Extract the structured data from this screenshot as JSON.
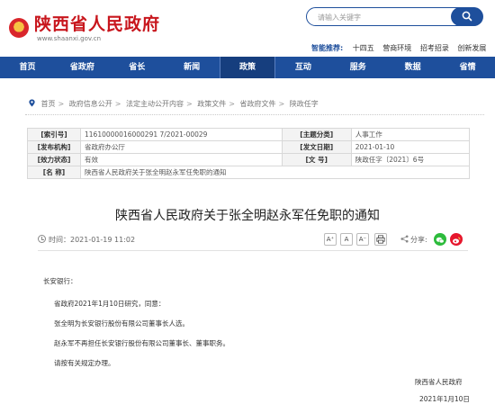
{
  "header": {
    "site_title": "陕西省人民政府",
    "site_url": "www.shaanxi.gov.cn",
    "search_placeholder": "请输入关键字",
    "hot_label": "智能推荐:",
    "hot_items": [
      "十四五",
      "营商环境",
      "招考招录",
      "创新发展"
    ]
  },
  "nav": {
    "tabs": [
      "首页",
      "省政府",
      "省长",
      "新闻",
      "政策",
      "互动",
      "服务",
      "数据",
      "省情"
    ],
    "active_index": 4
  },
  "breadcrumb": [
    "首页",
    "政府信息公开",
    "法定主动公开内容",
    "政策文件",
    "省政府文件",
    "陕政任字"
  ],
  "meta": {
    "index_label": "[索引号]",
    "index_value": "11610000016000291 7/2021-00029",
    "topic_label": "[主题分类]",
    "topic_value": "人事工作",
    "issuer_label": "[发布机构]",
    "issuer_value": "省政府办公厅",
    "date_label": "[发文日期]",
    "date_value": "2021-01-10",
    "status_label": "[效力状态]",
    "status_value": "有效",
    "docno_label": "[文    号]",
    "docno_value": "陕政任字〔2021〕6号",
    "name_label": "[名    称]",
    "name_value": "陕西省人民政府关于张全明赵永军任免职的通知"
  },
  "article": {
    "title": "陕西省人民政府关于张全明赵永军任免职的通知",
    "time": "时间：2021-01-19 11:02",
    "font_buttons": [
      "A⁺",
      "A",
      "A⁻"
    ],
    "share_label": "分享:",
    "paragraphs": [
      "长安银行：",
      "省政府2021年1月10日研究，同意：",
      "张全明为长安银行股份有限公司董事长人选。",
      "赵永军不再担任长安银行股份有限公司董事长、董事职务。",
      "请按有关规定办理。"
    ],
    "signature": "陕西省人民政府",
    "sign_date": "2021年1月10日"
  },
  "colors": {
    "brand_red": "#c8161d",
    "nav_blue": "#1e4f9c",
    "wechat_green": "#2dbb3c",
    "weibo_red": "#e6162d"
  }
}
